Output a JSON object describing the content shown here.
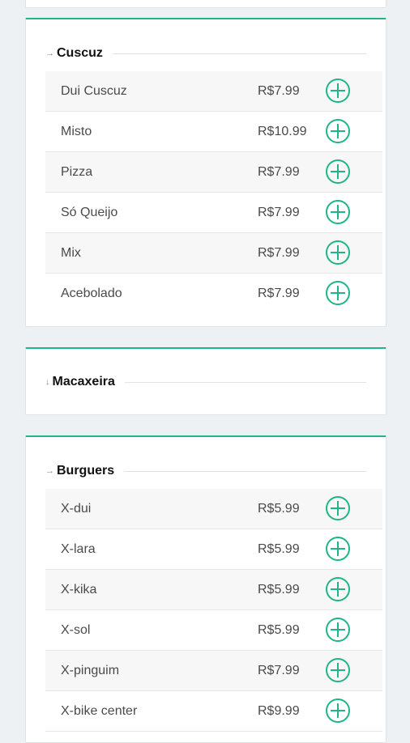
{
  "accent_color": "#1fb589",
  "categories": [
    {
      "arrow": "→",
      "title": "Cuscuz",
      "items": [
        {
          "name": "Dui Cuscuz",
          "price": "R$7.99"
        },
        {
          "name": "Misto",
          "price": "R$10.99"
        },
        {
          "name": "Pizza",
          "price": "R$7.99"
        },
        {
          "name": "Só Queijo",
          "price": "R$7.99"
        },
        {
          "name": "Mix",
          "price": "R$7.99"
        },
        {
          "name": "Acebolado",
          "price": "R$7.99"
        }
      ]
    },
    {
      "arrow": "↓",
      "title": "Macaxeira",
      "items": []
    },
    {
      "arrow": "→",
      "title": "Burguers",
      "items": [
        {
          "name": "X-dui",
          "price": "R$5.99"
        },
        {
          "name": "X-lara",
          "price": "R$5.99"
        },
        {
          "name": "X-kika",
          "price": "R$5.99"
        },
        {
          "name": "X-sol",
          "price": "R$5.99"
        },
        {
          "name": "X-pinguim",
          "price": "R$7.99"
        },
        {
          "name": "X-bike center",
          "price": "R$9.99"
        }
      ]
    }
  ],
  "add_icon": "plus-circle-icon"
}
